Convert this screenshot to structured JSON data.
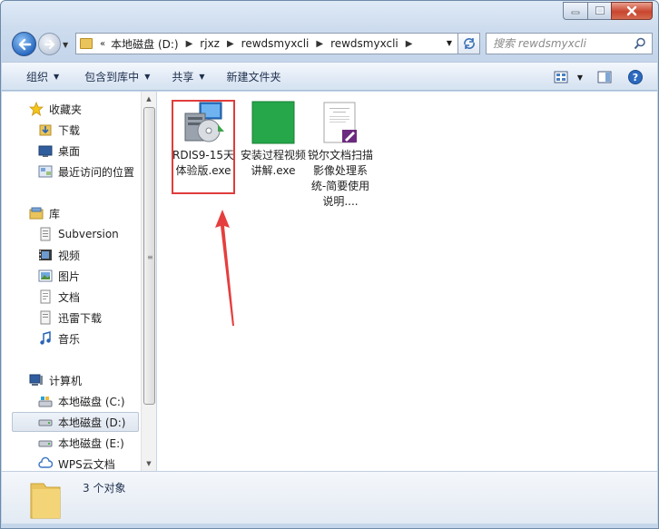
{
  "window": {
    "minimize_icon": "minimize-icon",
    "maximize_icon": "maximize-icon",
    "close_icon": "close-icon"
  },
  "navigation": {
    "breadcrumb": [
      "本地磁盘 (D:)",
      "rjxz",
      "rewdsmyxcli",
      "rewdsmyxcli"
    ],
    "breadcrumb_prefix": "«",
    "search_placeholder": "搜索 rewdsmyxcli"
  },
  "toolbar": {
    "organize": "组织",
    "include_in_library": "包含到库中",
    "share": "共享",
    "new_folder": "新建文件夹"
  },
  "sidebar": {
    "favorites": {
      "label": "收藏夹",
      "items": [
        "下载",
        "桌面",
        "最近访问的位置"
      ]
    },
    "libraries": {
      "label": "库",
      "items": [
        "Subversion",
        "视频",
        "图片",
        "文档",
        "迅雷下载",
        "音乐"
      ]
    },
    "computer": {
      "label": "计算机",
      "items": [
        "本地磁盘 (C:)",
        "本地磁盘 (D:)",
        "本地磁盘 (E:)",
        "WPS云文档"
      ]
    }
  },
  "files": [
    {
      "name": "RDIS9-15天体验版.exe",
      "icon": "installer-exe-icon"
    },
    {
      "name": "安装过程视频讲解.exe",
      "icon": "green-video-exe-icon"
    },
    {
      "name": "锐尔文档扫描影像处理系统-简要使用说明....",
      "icon": "document-icon"
    }
  ],
  "status": {
    "count_text": "3 个对象"
  },
  "colors": {
    "highlight": "#e03c3c",
    "chrome": "#c5d6eb",
    "close_button": "#c8452e"
  }
}
